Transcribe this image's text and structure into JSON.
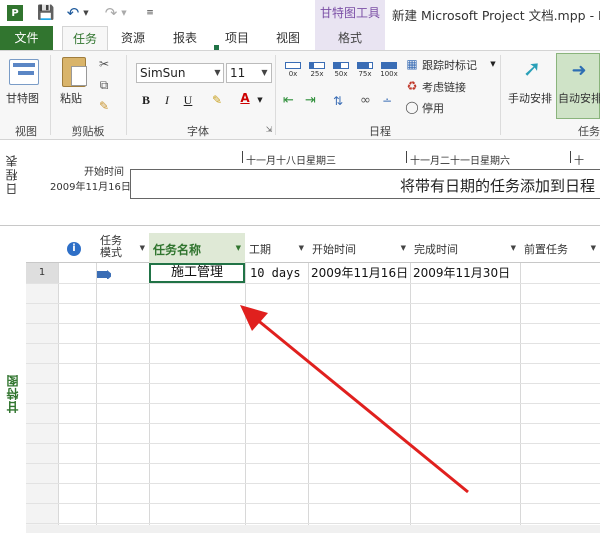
{
  "titlebar": {
    "app_icon": "P",
    "context_tab": "甘特图工具",
    "window_title": "新建 Microsoft Project 文档.mpp - Pro"
  },
  "tabs": {
    "file": "文件",
    "task": "任务",
    "resource": "资源",
    "report": "报表",
    "project": "项目",
    "view": "视图",
    "format": "格式"
  },
  "ribbon": {
    "view_group": {
      "button_label": "甘特图",
      "group_label": "视图"
    },
    "clipboard_group": {
      "paste_label": "粘贴",
      "group_label": "剪贴板"
    },
    "font_group": {
      "font_name": "SimSun",
      "font_size": "11",
      "bold": "B",
      "italic": "I",
      "underline": "U",
      "font_color_letter": "A",
      "group_label": "字体"
    },
    "schedule_group": {
      "percent_labels": [
        "0x",
        "25x",
        "50x",
        "75x",
        "100x"
      ],
      "percent_values": [
        0,
        25,
        50,
        75,
        100
      ],
      "mark_on_track": "跟踪时标记",
      "respect_links": "考虑链接",
      "inactivate": "停用",
      "group_label": "日程"
    },
    "tasks_group": {
      "manual_schedule": "手动安排",
      "auto_schedule": "自动安排",
      "group_label_partial": "任务"
    }
  },
  "timeline": {
    "side_label": "日程表",
    "start_label": "开始时间",
    "start_date": "2009年11月16日",
    "dates": [
      "十一月十八日星期三",
      "十一月二十一日星期六"
    ],
    "placeholder": "将带有日期的任务添加到日程"
  },
  "grid": {
    "side_label": "甘特图",
    "columns": {
      "mode": "任务\n模式",
      "name": "任务名称",
      "duration": "工期",
      "start": "开始时间",
      "finish": "完成时间",
      "predecessors": "前置任务"
    },
    "rows": [
      {
        "id": "1",
        "name": "施工管理",
        "duration": "10 days",
        "start": "2009年11月16日",
        "finish": "2009年11月30日"
      }
    ]
  },
  "colors": {
    "accent_green": "#31752f",
    "context_purple": "#e9e4f2",
    "arrow_red": "#e0201e"
  }
}
